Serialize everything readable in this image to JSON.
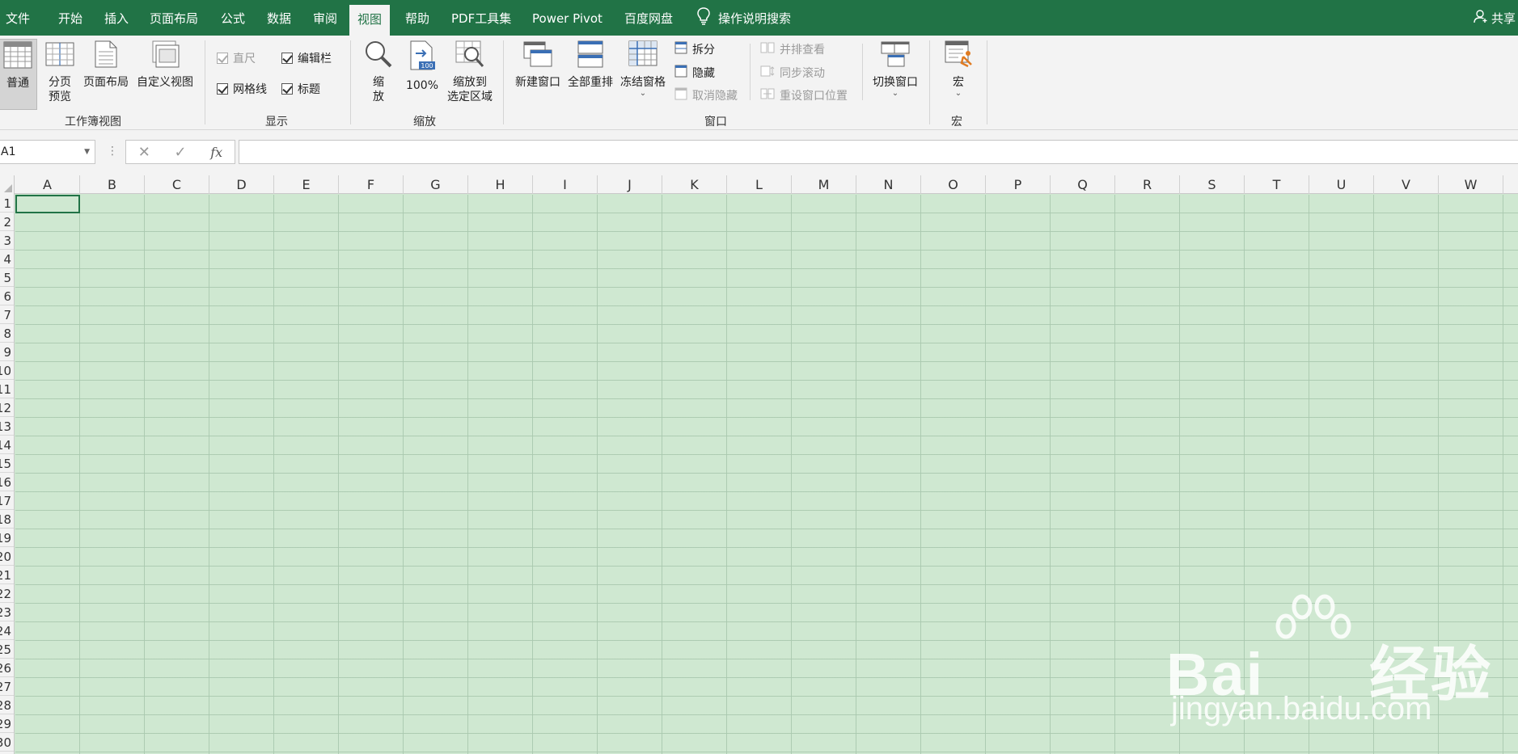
{
  "colors": {
    "accent": "#217346",
    "ribbon_bg": "#f3f3f3",
    "cell_bg": "#cfe8d1"
  },
  "tabs": [
    {
      "label": "文件"
    },
    {
      "label": "开始"
    },
    {
      "label": "插入"
    },
    {
      "label": "页面布局"
    },
    {
      "label": "公式"
    },
    {
      "label": "数据"
    },
    {
      "label": "审阅"
    },
    {
      "label": "视图",
      "active": true
    },
    {
      "label": "帮助"
    },
    {
      "label": "PDF工具集"
    },
    {
      "label": "Power Pivot"
    },
    {
      "label": "百度网盘"
    }
  ],
  "search": {
    "label": "操作说明搜索",
    "icon": "lightbulb-icon"
  },
  "share": {
    "label": "共享",
    "icon": "person-icon"
  },
  "ribbon": {
    "workbook_views": {
      "label": "工作簿视图",
      "normal": "普通",
      "page_break_1": "分页",
      "page_break_2": "预览",
      "page_layout": "页面布局",
      "custom_views": "自定义视图"
    },
    "show": {
      "label": "显示",
      "ruler": "直尺",
      "formula_bar": "编辑栏",
      "gridlines": "网格线",
      "headings": "标题"
    },
    "zoom": {
      "label": "缩放",
      "zoom_1": "缩",
      "zoom_2": "放",
      "zoom_100": "100%",
      "zoom_sel_1": "缩放到",
      "zoom_sel_2": "选定区域"
    },
    "window": {
      "label": "窗口",
      "new_window": "新建窗口",
      "arrange_all": "全部重排",
      "freeze_panes": "冻结窗格",
      "split": "拆分",
      "hide": "隐藏",
      "unhide": "取消隐藏",
      "view_side_by_side": "并排查看",
      "sync_scroll": "同步滚动",
      "reset_position": "重设窗口位置",
      "switch_windows": "切换窗口"
    },
    "macros": {
      "label": "宏",
      "macros": "宏"
    }
  },
  "formula_bar": {
    "name_box": "A1",
    "formula": ""
  },
  "columns": [
    "A",
    "B",
    "C",
    "D",
    "E",
    "F",
    "G",
    "H",
    "I",
    "J",
    "K",
    "L",
    "M",
    "N",
    "O",
    "P",
    "Q",
    "R",
    "S",
    "T",
    "U",
    "V",
    "W"
  ],
  "rows": [
    "1",
    "2",
    "3",
    "4",
    "5",
    "6",
    "7",
    "8",
    "9",
    "10",
    "11",
    "12",
    "13",
    "14",
    "15",
    "16",
    "17",
    "18",
    "19",
    "20",
    "21",
    "22",
    "23",
    "24",
    "25",
    "26",
    "27",
    "28",
    "29",
    "30"
  ],
  "watermark": {
    "main": "Bai",
    "main_cn": "经验",
    "url": "jingyan.baidu.com"
  }
}
